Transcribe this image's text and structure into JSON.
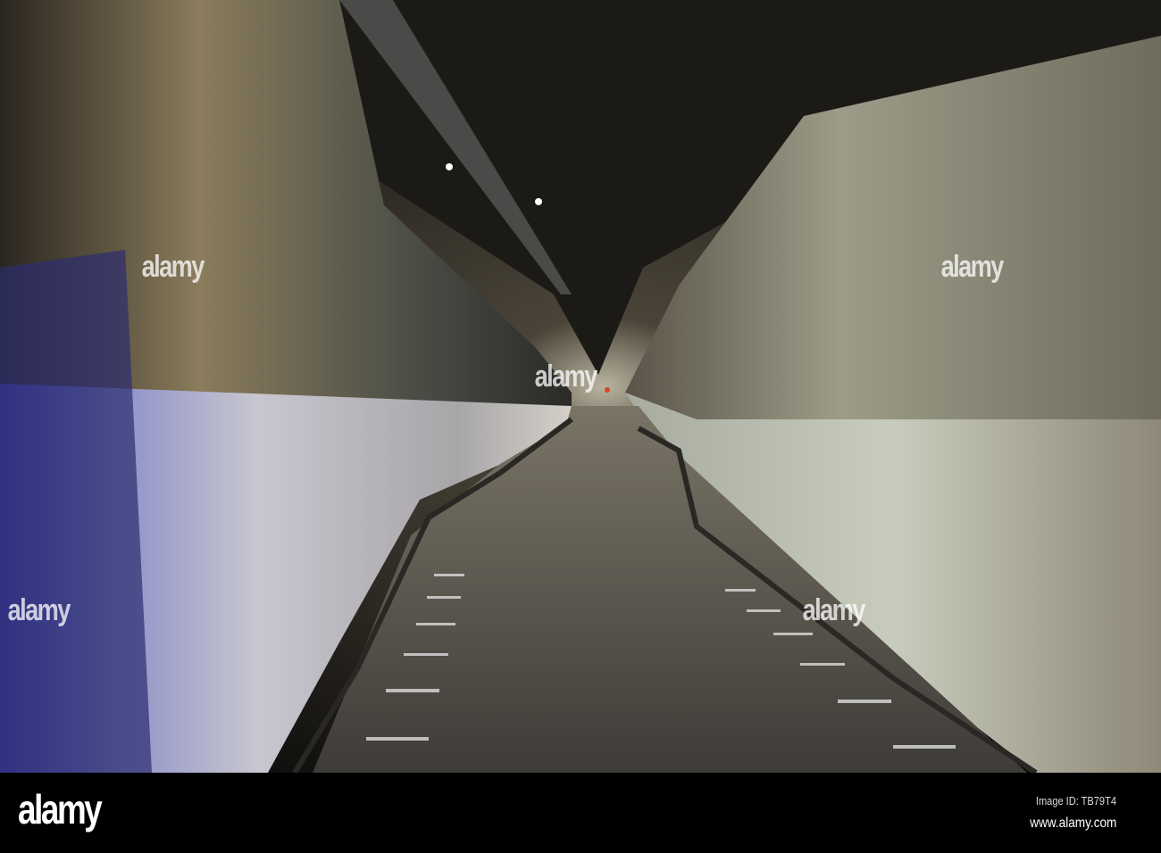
{
  "photo": {
    "subject": "underground tunnel road",
    "watermark_text": "alamy"
  },
  "footer": {
    "logo": "alamy",
    "image_id": "Image ID: TB79T4",
    "website": "www.alamy.com"
  }
}
